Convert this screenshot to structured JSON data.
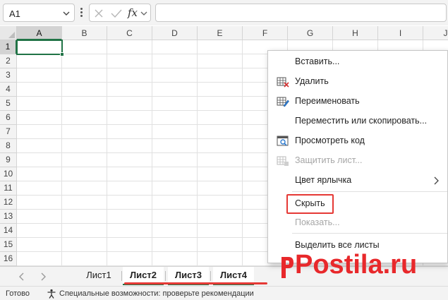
{
  "formula_bar": {
    "name_box_value": "A1",
    "fx_label": "fx",
    "formula_value": ""
  },
  "grid": {
    "columns": [
      "A",
      "B",
      "C",
      "D",
      "E",
      "F",
      "G",
      "H",
      "I",
      "J"
    ],
    "rows": [
      "1",
      "2",
      "3",
      "4",
      "5",
      "6",
      "7",
      "8",
      "9",
      "10",
      "11",
      "12",
      "13",
      "14",
      "15",
      "16"
    ],
    "active_cell": "A1"
  },
  "sheet_tabs": {
    "tabs": [
      "Лист1",
      "Лист2",
      "Лист3",
      "Лист4"
    ],
    "selected": [
      "Лист2",
      "Лист3",
      "Лист4"
    ]
  },
  "status_bar": {
    "ready": "Готово",
    "accessibility": "Специальные возможности: проверьте рекомендации"
  },
  "context_menu": {
    "items": [
      {
        "label": "Вставить...",
        "icon": "",
        "disabled": false
      },
      {
        "label": "Удалить",
        "icon": "delete-sheet-icon",
        "disabled": false
      },
      {
        "label": "Переименовать",
        "icon": "rename-sheet-icon",
        "disabled": false
      },
      {
        "label": "Переместить или скопировать...",
        "icon": "",
        "disabled": false
      },
      {
        "label": "Просмотреть код",
        "icon": "view-code-icon",
        "disabled": false
      },
      {
        "label": "Защитить лист...",
        "icon": "protect-sheet-icon",
        "disabled": true
      },
      {
        "label": "Цвет ярлычка",
        "icon": "",
        "disabled": false,
        "submenu": true
      },
      {
        "label": "Скрыть",
        "icon": "",
        "disabled": false,
        "highlighted": true
      },
      {
        "label": "Показать...",
        "icon": "",
        "disabled": true
      },
      {
        "label": "Выделить все листы",
        "icon": "",
        "disabled": false
      }
    ]
  },
  "watermark": {
    "text": "Postila.ru"
  },
  "colors": {
    "excel_green": "#217346",
    "highlight_red": "#e53935",
    "watermark_red": "#e8282b"
  }
}
